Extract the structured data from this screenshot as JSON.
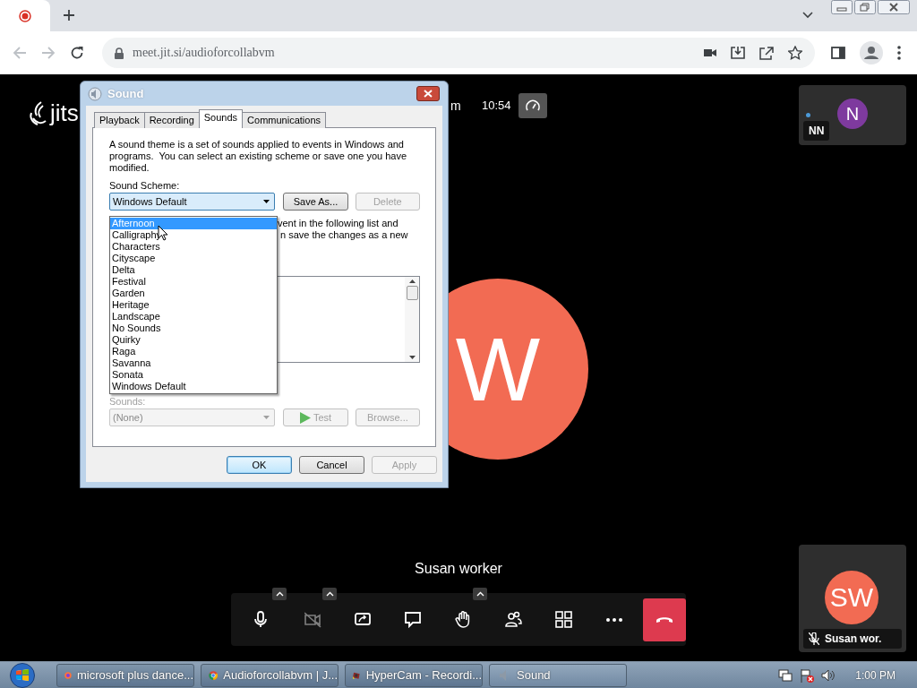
{
  "browser": {
    "tabs": [
      {
        "kind": "recording",
        "selected": true
      }
    ],
    "address_bar": {
      "url": "meet.jit.si/audioforcollabvm"
    }
  },
  "meeting": {
    "logo_text": "jits",
    "meeting_name": "m",
    "timer": "10:54",
    "speaker": {
      "initials": "W",
      "color": "#f26b53"
    },
    "speaker_name": "Susan worker",
    "thumbnails": [
      {
        "initials": "N",
        "name": "NN",
        "color": "#7e3a9e",
        "muted": false,
        "dot": true
      },
      {
        "initials": "SW",
        "name": "Susan wor.",
        "color": "#f26b53",
        "muted": true,
        "dot": false
      }
    ],
    "toolbar": [
      {
        "kind": "mic",
        "caret": true,
        "disabled": false
      },
      {
        "kind": "camera",
        "caret": true,
        "disabled": true
      },
      {
        "kind": "share",
        "caret": false,
        "disabled": false
      },
      {
        "kind": "chat",
        "caret": false,
        "disabled": false
      },
      {
        "kind": "hand",
        "caret": true,
        "disabled": false
      },
      {
        "kind": "participants",
        "caret": false,
        "disabled": false
      },
      {
        "kind": "tiles",
        "caret": false,
        "disabled": false
      },
      {
        "kind": "more",
        "caret": false,
        "disabled": false
      },
      {
        "kind": "hangup",
        "caret": false,
        "disabled": false
      }
    ]
  },
  "dialog": {
    "title": "Sound",
    "tabs": [
      {
        "label": "Playback",
        "selected": false
      },
      {
        "label": "Recording",
        "selected": false
      },
      {
        "label": "Sounds",
        "selected": true
      },
      {
        "label": "Communications",
        "selected": false
      }
    ],
    "description": "A sound theme is a set of sounds applied to events in Windows and programs.  You can select an existing scheme or save one you have modified.",
    "scheme_label": "Sound Scheme:",
    "scheme_value": "Windows Default",
    "scheme_buttons": [
      {
        "label": "Save As...",
        "disabled": false
      },
      {
        "label": "Delete",
        "disabled": true
      }
    ],
    "dropdown": [
      {
        "label": "Afternoon",
        "selected": true
      },
      {
        "label": "Calligraphy",
        "selected": false
      },
      {
        "label": "Characters",
        "selected": false
      },
      {
        "label": "Cityscape",
        "selected": false
      },
      {
        "label": "Delta",
        "selected": false
      },
      {
        "label": "Festival",
        "selected": false
      },
      {
        "label": "Garden",
        "selected": false
      },
      {
        "label": "Heritage",
        "selected": false
      },
      {
        "label": "Landscape",
        "selected": false
      },
      {
        "label": "No Sounds",
        "selected": false
      },
      {
        "label": "Quirky",
        "selected": false
      },
      {
        "label": "Raga",
        "selected": false
      },
      {
        "label": "Savanna",
        "selected": false
      },
      {
        "label": "Sonata",
        "selected": false
      },
      {
        "label": "Windows Default",
        "selected": false
      }
    ],
    "partial_text": [
      "vent in the following list and",
      "n save the changes as a new"
    ],
    "sounds": {
      "label": "Sounds:",
      "value": "(None)",
      "disabled": true
    },
    "sound_buttons": [
      {
        "label": "Test",
        "kind": "play",
        "disabled": true
      },
      {
        "label": "Browse...",
        "kind": "plain",
        "disabled": true
      }
    ],
    "buttons": [
      {
        "label": "OK",
        "default": true,
        "disabled": false
      },
      {
        "label": "Cancel",
        "default": false,
        "disabled": false
      },
      {
        "label": "Apply",
        "default": false,
        "disabled": true
      }
    ]
  },
  "taskbar": {
    "items": [
      {
        "label": "microsoft plus dance...",
        "kind": "firefox",
        "selected": false
      },
      {
        "label": "Audioforcollabvm | J...",
        "kind": "chrome",
        "selected": false
      },
      {
        "label": "HyperCam - Recordi...",
        "kind": "hypercam",
        "selected": false
      },
      {
        "label": "Sound",
        "kind": "speaker",
        "selected": true
      }
    ],
    "clock": "1:00 PM"
  }
}
